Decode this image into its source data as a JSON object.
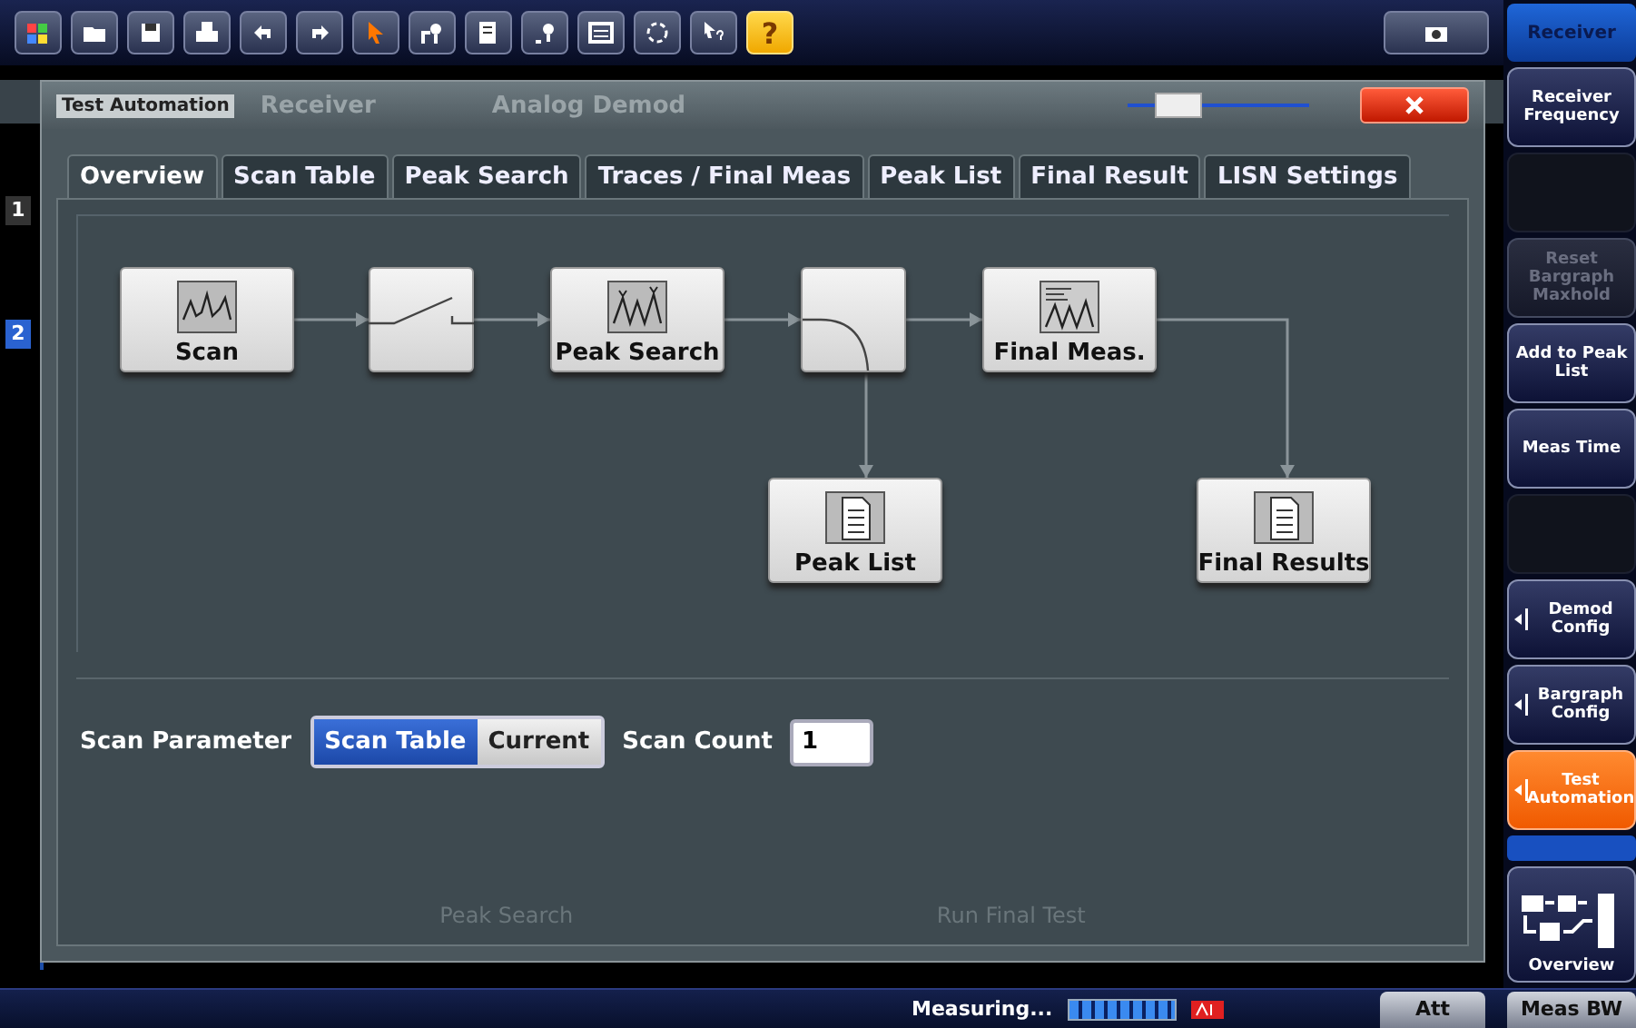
{
  "toolbar": {
    "help_label": "?"
  },
  "background": {
    "window_numbers": [
      {
        "label": "1",
        "selected": false
      },
      {
        "label": "2",
        "selected": true
      }
    ]
  },
  "window": {
    "title": "Test Automation",
    "background_tabs": [
      "Receiver",
      "Analog Demod"
    ],
    "transparency": {
      "level": 0.2
    }
  },
  "tabs": [
    {
      "label": "Overview",
      "selected": true
    },
    {
      "label": "Scan Table",
      "selected": false
    },
    {
      "label": "Peak Search",
      "selected": false
    },
    {
      "label": "Traces / Final Meas",
      "selected": false
    },
    {
      "label": "Peak List",
      "selected": false
    },
    {
      "label": "Final Result",
      "selected": false
    },
    {
      "label": "LISN Settings",
      "selected": false
    }
  ],
  "diagram": {
    "nodes": [
      {
        "kind": "scan",
        "label": "Scan"
      },
      {
        "kind": "switch"
      },
      {
        "kind": "peak_search",
        "label": "Peak Search"
      },
      {
        "kind": "splitter"
      },
      {
        "kind": "final_meas",
        "label": "Final Meas."
      },
      {
        "kind": "list",
        "label": "Peak List"
      },
      {
        "kind": "results",
        "label": "Final Results"
      }
    ]
  },
  "scan_parameter": {
    "label": "Scan Parameter",
    "options": [
      {
        "label": "Scan Table",
        "selected": true
      },
      {
        "label": "Current",
        "selected": false
      }
    ]
  },
  "scan_count": {
    "label": "Scan Count",
    "value": "1"
  },
  "actions": [
    {
      "label": "Peak Search",
      "disabled": true
    },
    {
      "label": "Run Final Test",
      "disabled": true
    }
  ],
  "softkeys": [
    {
      "kind": "header",
      "label": "Receiver"
    },
    {
      "kind": "key",
      "label": "Receiver Frequency",
      "selected": false,
      "disabled": false,
      "submenu": false
    },
    {
      "kind": "blank"
    },
    {
      "kind": "key",
      "label": "Reset Bargraph Maxhold",
      "selected": false,
      "disabled": true,
      "submenu": false
    },
    {
      "kind": "key",
      "label": "Add to Peak List",
      "selected": false,
      "disabled": false,
      "submenu": false
    },
    {
      "kind": "key",
      "label": "Meas Time",
      "selected": false,
      "disabled": false,
      "submenu": false
    },
    {
      "kind": "blank"
    },
    {
      "kind": "key",
      "label": "Demod Config",
      "selected": false,
      "disabled": false,
      "submenu": true
    },
    {
      "kind": "key",
      "label": "Bargraph Config",
      "selected": false,
      "disabled": false,
      "submenu": true
    },
    {
      "kind": "key",
      "label": "Test Automation",
      "selected": true,
      "disabled": false,
      "submenu": true
    },
    {
      "kind": "spacer"
    },
    {
      "kind": "overview",
      "label": "Overview"
    }
  ],
  "status_bar": {
    "text": "Measuring...",
    "level": 1.0,
    "keys": [
      "Att",
      "Meas BW"
    ]
  }
}
